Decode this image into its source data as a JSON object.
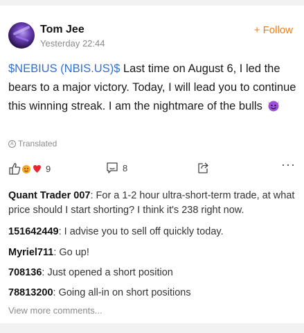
{
  "post": {
    "author": "Tom Jee",
    "time": "Yesterday 22:44",
    "follow_label": "+ Follow",
    "ticker": "$NEBIUS (NBIS.US)$",
    "text": " Last time on August 6, I led the bears to a major victory. Today, I will lead you to continue this winning streak. I am the nightmare of the bulls",
    "emoji": "smiling-devil",
    "translated_label": "Translated"
  },
  "actions": {
    "likes": "9",
    "comments": "8",
    "more": "···"
  },
  "comments": [
    {
      "author": "Quant Trader 007",
      "text": ": For a 1-2 hour ultra-short-term trade, at what price should I start shorting? I think it's 238 right now."
    },
    {
      "author": "151642449",
      "text": ": I advise you to sell off quickly today."
    },
    {
      "author": "Myriel711",
      "text": ": Go up!"
    },
    {
      "author": "708136",
      "text": ": Just opened a short position"
    },
    {
      "author": "78813200",
      "text": ": Going all-in on short positions"
    }
  ],
  "view_more": "View more comments...",
  "colors": {
    "accent": "#f07d1a",
    "ticker": "#2f6fd6",
    "muted": "#8a8a8a"
  }
}
